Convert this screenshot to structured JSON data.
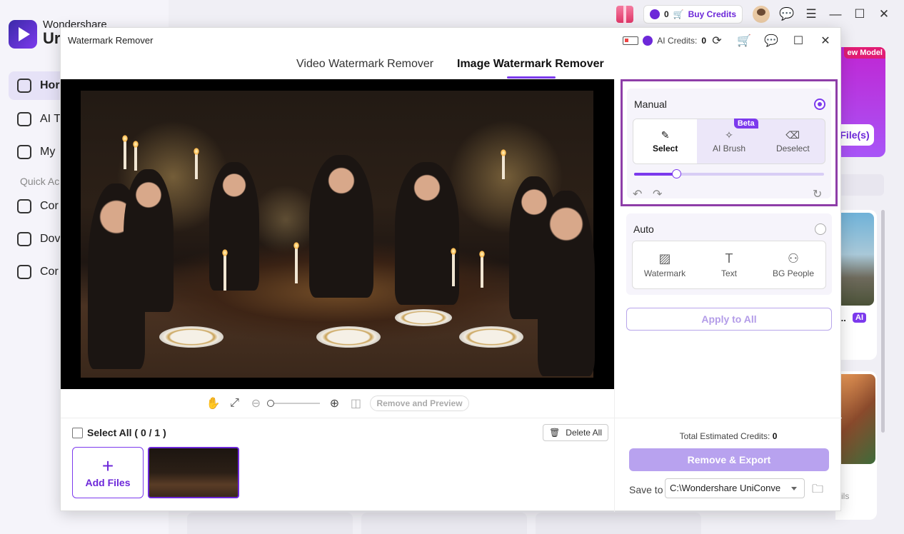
{
  "bg_app": {
    "brand_line1": "Wondershare",
    "brand_line2": "Ur",
    "nav": [
      {
        "label": "Hor",
        "icon": "home-icon"
      },
      {
        "label": "AI To",
        "icon": "ai-tools-icon"
      },
      {
        "label": "My",
        "icon": "my-files-icon"
      },
      {
        "label": "Cor",
        "icon": "converter-icon"
      },
      {
        "label": "Dov",
        "icon": "downloader-icon"
      },
      {
        "label": "Cor",
        "icon": "compressor-icon"
      }
    ],
    "quick_label": "Quick Ac",
    "credits_count": "0",
    "buy_credits": "Buy Credits",
    "promo_badge": "ew Model",
    "promo_button": "File(s)",
    "card_dots": "...",
    "card_ai": "AI",
    "card2_text": "ils"
  },
  "dialog": {
    "title": "Watermark Remover",
    "ai_credits_label": "AI Credits:",
    "ai_credits_value": "0",
    "tabs": [
      "Video Watermark Remover",
      "Image Watermark Remover"
    ],
    "active_tab": 1
  },
  "toolbar": {
    "remove_preview": "Remove and Preview",
    "zoom_level": 0
  },
  "files": {
    "select_all": "Select All ( 0 / 1 )",
    "delete_all": "Delete All",
    "add_files": "Add Files",
    "plus": "+"
  },
  "manual": {
    "label": "Manual",
    "modes": [
      {
        "label": "Select",
        "icon": "brush-icon",
        "glyph": "✎"
      },
      {
        "label": "AI Brush",
        "icon": "magic-wand-icon",
        "glyph": "✧"
      },
      {
        "label": "Deselect",
        "icon": "eraser-icon",
        "glyph": "⌫"
      }
    ],
    "beta": "Beta",
    "brush_size_fraction": 0.22
  },
  "auto": {
    "label": "Auto",
    "modes": [
      {
        "label": "Watermark",
        "icon": "watermark-icon",
        "glyph": "▨"
      },
      {
        "label": "Text",
        "icon": "text-icon",
        "glyph": "T"
      },
      {
        "label": "BG People",
        "icon": "people-icon",
        "glyph": "⚇"
      }
    ]
  },
  "apply_all": "Apply to All",
  "export": {
    "est_label": "Total Estimated Credits:",
    "est_value": "0",
    "button": "Remove & Export",
    "save_to": "Save to",
    "path": "C:\\Wondershare UniConve"
  },
  "colors": {
    "accent": "#7c3aed",
    "highlight_border": "#8e3ea8",
    "disabled_button": "#b8a2ef"
  }
}
